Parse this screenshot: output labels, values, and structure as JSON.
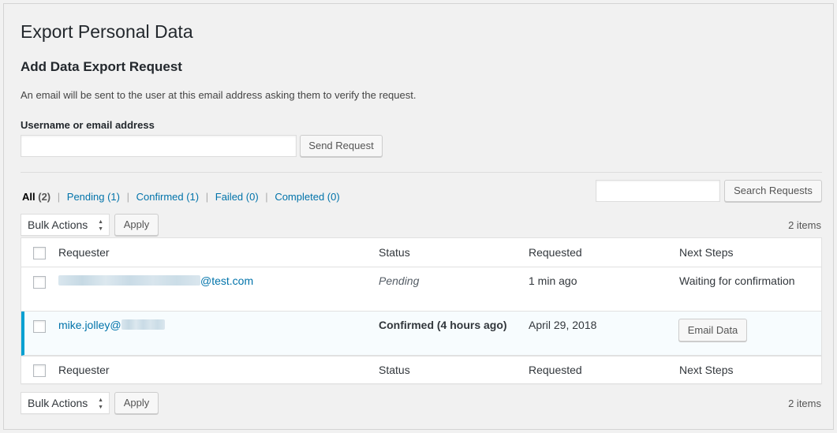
{
  "page": {
    "title": "Export Personal Data",
    "section_title": "Add Data Export Request",
    "description": "An email will be sent to the user at this email address asking them to verify the request.",
    "field_label": "Username or email address",
    "email_value": "",
    "send_button": "Send Request"
  },
  "filters": {
    "all": "All",
    "all_count": "(2)",
    "separator": "|",
    "links": [
      "Pending (1)",
      "Confirmed (1)",
      "Failed (0)",
      "Completed (0)"
    ]
  },
  "search": {
    "value": "",
    "button": "Search Requests"
  },
  "bulk": {
    "select_label": "Bulk Actions",
    "apply_label": "Apply",
    "items_count": "2 items"
  },
  "table": {
    "columns": [
      "Requester",
      "Status",
      "Requested",
      "Next Steps"
    ],
    "rows": [
      {
        "requester_suffix": "@test.com",
        "status": "Pending",
        "requested": "1 min ago",
        "next_steps": "Waiting for confirmation"
      },
      {
        "requester_prefix": "mike.jolley@",
        "status": "Confirmed (4 hours ago)",
        "requested": "April 29, 2018",
        "next_steps_button": "Email Data"
      }
    ]
  },
  "colors": {
    "link": "#0073aa",
    "highlight_border": "#00a0d2",
    "background": "#f1f1f1"
  }
}
